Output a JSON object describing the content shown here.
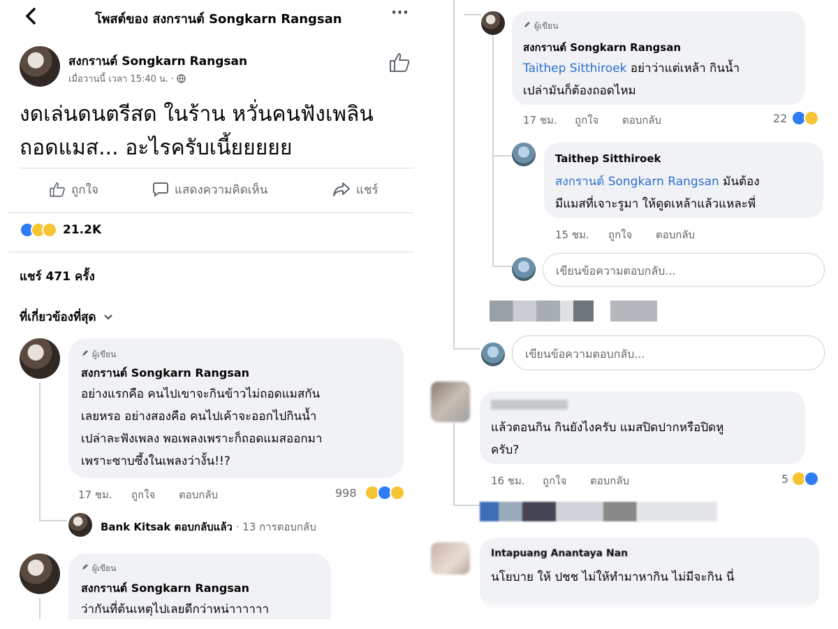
{
  "header": {
    "back_icon": "chevron-left-icon",
    "title": "โพสต์ของ สงกรานต์ Songkarn Rangsan",
    "more": "···"
  },
  "post": {
    "author": "สงกรานต์ Songkarn Rangsan",
    "timestamp": "เมื่อวานนี้ เวลา 15:40 น. · ",
    "text_line1": "งดเล่นดนตรีสด ในร้าน หวั่นคนฟังเพลิน",
    "text_line2": "ถอดแมส... อะไรครับเนี้ยยยยย",
    "actions": {
      "like": "ถูกใจ",
      "comment": "แสดงความคิดเห็น",
      "share": "แชร์"
    },
    "reaction_count": "21.2K",
    "shares": "แชร์ 471 ครั้ง",
    "sort_label": "ที่เกี่ยวข้องที่สุด"
  },
  "left_comments": [
    {
      "badge": "ผู้เขียน",
      "author": "สงกรานต์ Songkarn Rangsan",
      "lines": [
        "อย่างแรกคือ คนไปเขาจะกินข้าวไม่ถอดแมสกัน",
        "เลยหรอ อย่างสองคือ คนไปเค้าจะออกไปกินน้ำ",
        "เปล่าละฟังเพลง พอเพลงเพราะก็ถอดแมสออกมา",
        "เพราะซาบซึ้งในเพลงว่างั้น!!?"
      ],
      "time": "17 ชม.",
      "like": "ถูกใจ",
      "reply": "ตอบกลับ",
      "count": "998"
    },
    {
      "badge": "ผู้เขียน",
      "author": "สงกรานต์ Songkarn Rangsan",
      "lines": [
        "ว่ากันที่ต้นเหตุไปเลยดีกว่าหน่าาาาาา"
      ]
    }
  ],
  "reply_summary": {
    "name": "Bank Kitsak ตอบกลับแล้ว",
    "count": " · 13 การตอบกลับ"
  },
  "right_comments": [
    {
      "badge": "ผู้เขียน",
      "author": "สงกรานต์ Songkarn Rangsan",
      "mention": "Taithep Sitthiroek",
      "line1_rest": " อย่าว่าแต่เหล้า กินน้ำ",
      "line2": "เปล่ามันก็ต้องถอดไหม",
      "time": "17 ชม.",
      "like": "ถูกใจ",
      "reply": "ตอบกลับ",
      "count": "22"
    },
    {
      "author": "Taithep Sitthiroek",
      "mention": "สงกรานต์ Songkarn Rangsan",
      "line1_rest": " มันต้อง",
      "line2": "มีแมสที่เจาะรูมา ให้ดูดเหล้าแล้วแหละพี่",
      "time": "15 ชม.",
      "like": "ถูกใจ",
      "reply": "ตอบกลับ"
    },
    {
      "lines": [
        "แล้วตอนกิน กินยังไงครับ แมสปิดปากหรือปิดหู",
        "ครับ?"
      ],
      "time": "16 ชม.",
      "like": "ถูกใจ",
      "reply": "ตอบกลับ",
      "count": "5"
    },
    {
      "author": "Intapuang Anantaya Nan",
      "lines": [
        "นโยบาย ให้ ปชช ไม่ให้ทำมาหากิน ไม่มีจะกิน นี่"
      ]
    }
  ],
  "reply_input": {
    "placeholder": "เขียนข้อความตอบกลับ..."
  },
  "colors": {
    "link": "#2f6fd1",
    "bubble": "#f0f2f5",
    "muted": "#65676b",
    "like": "#2e7cf6",
    "haha": "#f7c433"
  }
}
